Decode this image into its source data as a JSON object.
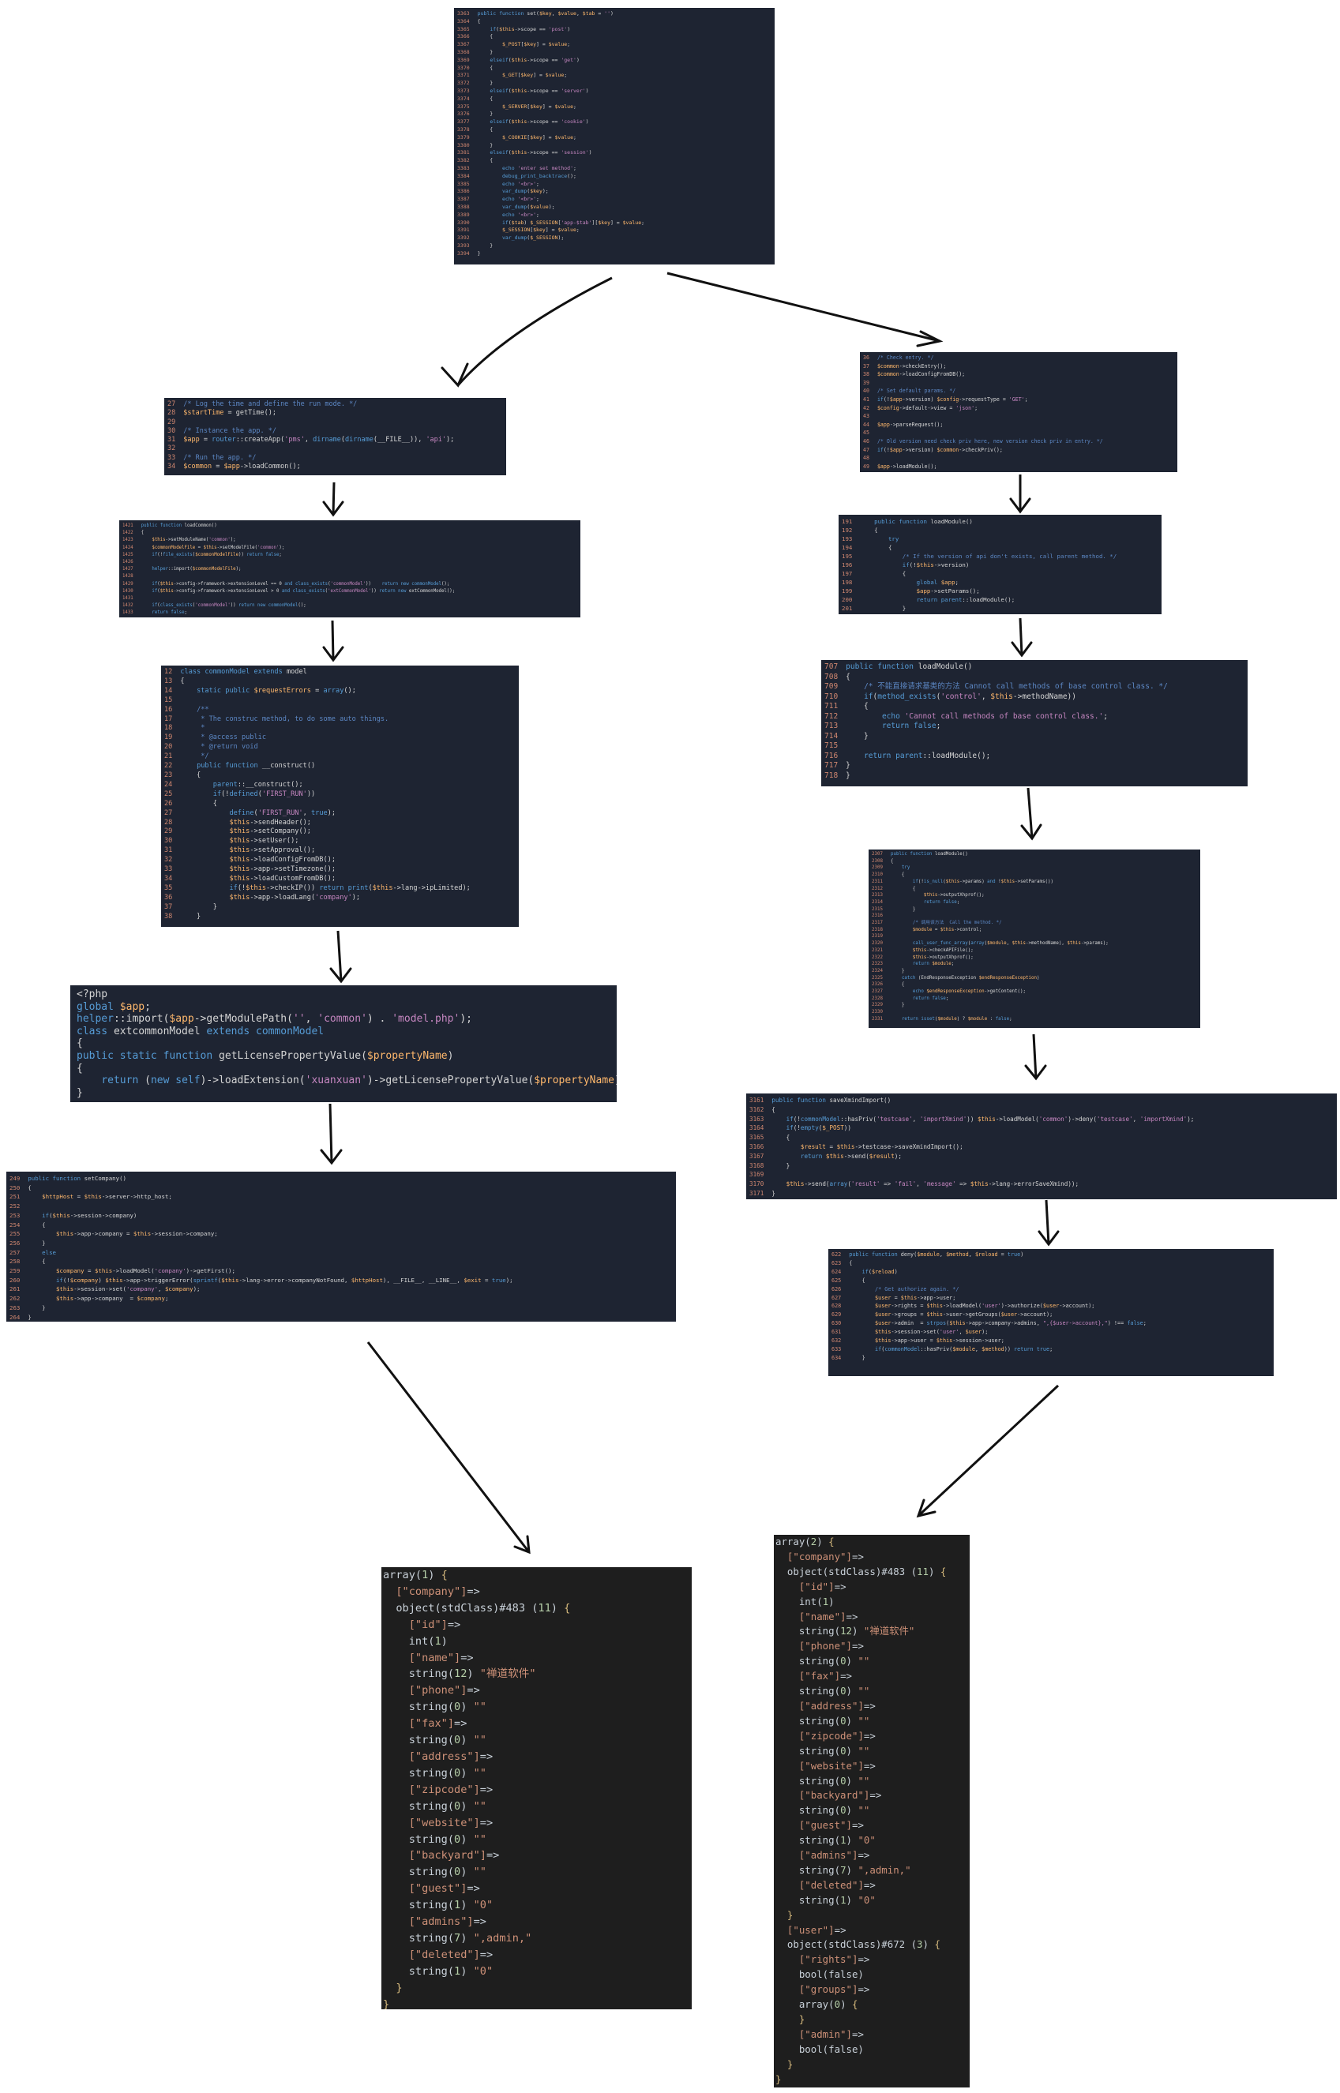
{
  "panels": {
    "top_set": {
      "start": 3363,
      "lines": [
        "public function set($key, $value, $tab = '')",
        "{",
        "    if($this->scope == 'post')",
        "    {",
        "        $_POST[$key] = $value;",
        "    }",
        "    elseif($this->scope == 'get')",
        "    {",
        "        $_GET[$key] = $value;",
        "    }",
        "    elseif($this->scope == 'server')",
        "    {",
        "        $_SERVER[$key] = $value;",
        "    }",
        "    elseif($this->scope == 'cookie')",
        "    {",
        "        $_COOKIE[$key] = $value;",
        "    }",
        "    elseif($this->scope == 'session')",
        "    {",
        "        echo 'enter set method';",
        "        debug_print_backtrace();",
        "        echo '<br>';",
        "        var_dump($key);",
        "        echo '<br>';",
        "        var_dump($value);",
        "        echo '<br>';",
        "        if($tab) $_SESSION['app-$tab'][$key] = $value;",
        "        $_SESSION[$key] = $value;",
        "        var_dump($_SESSION);",
        "    }",
        "}"
      ]
    },
    "left_run": {
      "start": 27,
      "lines": [
        "/* Log the time and define the run mode. */",
        "$startTime = getTime();",
        "",
        "/* Instance the app. */",
        "$app = router::createApp('pms', dirname(dirname(__FILE__)), 'api');",
        "",
        "/* Run the app. */",
        "$common = $app->loadCommon();"
      ]
    },
    "left_loadcommon": {
      "start": 1421,
      "lines": [
        "public function loadCommon()",
        "{",
        "    $this->setModuleName('common');",
        "    $commonModelFile = $this->setModelFile('common');",
        "    if(!file_exists($commonModelFile)) return false;",
        "",
        "    helper::import($commonModelFile);",
        "",
        "    if($this->config->framework->extensionLevel == 0 and class_exists('commonModel'))    return new commonModel();",
        "    if($this->config->framework->extensionLevel > 0 and class_exists('extCommonModel')) return new extCommonModel();",
        "",
        "    if(class_exists('commonModel')) return new commonModel();",
        "    return false;"
      ]
    },
    "left_commonmodel": {
      "start": 12,
      "lines": [
        "class commonModel extends model",
        "{",
        "    static public $requestErrors = array();",
        "",
        "    /**",
        "     * The construc method, to do some auto things.",
        "     *",
        "     * @access public",
        "     * @return void",
        "     */",
        "    public function __construct()",
        "    {",
        "        parent::__construct();",
        "        if(!defined('FIRST_RUN'))",
        "        {",
        "            define('FIRST_RUN', true);",
        "            $this->sendHeader();",
        "            $this->setCompany();",
        "            $this->setUser();",
        "            $this->setApproval();",
        "            $this->loadConfigFromDB();",
        "            $this->app->setTimezone();",
        "            $this->loadCustomFromDB();",
        "            if(!$this->checkIP()) return print($this->lang->ipLimited);",
        "            $this->app->loadLang('company');",
        "        }",
        "    }"
      ]
    },
    "left_ext": {
      "lines": [
        "<?php",
        "global $app;",
        "helper::import($app->getModulePath('', 'common') . 'model.php');",
        "class extcommonModel extends commonModel",
        "{",
        "public static function getLicensePropertyValue($propertyName)",
        "{",
        "    return (new self)->loadExtension('xuanxuan')->getLicensePropertyValue($propertyName);",
        "}"
      ]
    },
    "left_setcompany": {
      "start": 249,
      "lines": [
        "public function setCompany()",
        "{",
        "    $httpHost = $this->server->http_host;",
        "",
        "    if($this->session->company)",
        "    {",
        "        $this->app->company = $this->session->company;",
        "    }",
        "    else",
        "    {",
        "        $company = $this->loadModel('company')->getFirst();",
        "        if(!$company) $this->app->triggerError(sprintf($this->lang->error->companyNotFound, $httpHost), __FILE__, __LINE__, $exit = true);",
        "        $this->session->set('company', $company);",
        "        $this->app->company  = $company;",
        "    }",
        "}"
      ]
    },
    "right_checkentry": {
      "start": 36,
      "lines": [
        "/* Check entry. */",
        "$common->checkEntry();",
        "$common->loadConfigFromDB();",
        "",
        "/* Set default params. */",
        "if(!$app->version) $config->requestType = 'GET';",
        "$config->default->view = 'json';",
        "",
        "$app->parseRequest();",
        "",
        "/* Old version need check priv here, new version check priv in entry. */",
        "if(!$app->version) $common->checkPriv();",
        "",
        "$app->loadModule();"
      ]
    },
    "right_loadmodule1": {
      "start": 191,
      "lines": [
        "    public function loadModule()",
        "    {",
        "        try",
        "        {",
        "            /* If the version of api don't exists, call parent method. */",
        "            if(!$this->version)",
        "            {",
        "                global $app;",
        "                $app->setParams();",
        "                return parent::loadModule();",
        "            }"
      ]
    },
    "right_loadmodule2": {
      "start": 707,
      "lines": [
        "public function loadModule()",
        "{",
        "    /* 不能直接请求基类的方法 Cannot call methods of base control class. */",
        "    if(method_exists('control', $this->methodName))",
        "    {",
        "        echo 'Cannot call methods of base control class.';",
        "        return false;",
        "    }",
        "",
        "    return parent::loadModule();",
        "}",
        "}"
      ]
    },
    "right_loadmodule3": {
      "start": 2307,
      "lines": [
        "public function loadModule()",
        "{",
        "    try",
        "    {",
        "        if(!is_null($this->params) and !$this->setParams())",
        "        {",
        "            $this->outputXhprof();",
        "            return false;",
        "        }",
        "",
        "        /* 调用该方法  Call the method. */",
        "        $module = $this->control;",
        "",
        "        call_user_func_array(array($module, $this->methodName), $this->params);",
        "        $this->checkAPIFile();",
        "        $this->outputXhprof();",
        "        return $module;",
        "    }",
        "    catch (EndResponseException $endResponseException)",
        "    {",
        "        echo $endResponseException->getContent();",
        "        return false;",
        "    }",
        "",
        "    return isset($module) ? $module : false;"
      ]
    },
    "right_savexmind": {
      "start": 3161,
      "lines": [
        "public function saveXmindImport()",
        "{",
        "    if(!commonModel::hasPriv('testcase', 'importXmind')) $this->loadModel('common')->deny('testcase', 'importXmind');",
        "    if(!empty($_POST))",
        "    {",
        "        $result = $this->testcase->saveXmindImport();",
        "        return $this->send($result);",
        "    }",
        "",
        "    $this->send(array('result' => 'fail', 'message' => $this->lang->errorSaveXmind));",
        "}"
      ]
    },
    "right_deny": {
      "start": 622,
      "lines": [
        "public function deny($module, $method, $reload = true)",
        "{",
        "    if($reload)",
        "    {",
        "        /* Get authorize again. */",
        "        $user = $this->app->user;",
        "        $user->rights = $this->loadModel('user')->authorize($user->account);",
        "        $user->groups = $this->user->getGroups($user->account);",
        "        $user->admin  = strpos($this->app->company->admins, \",{$user->account},\") !== false;",
        "        $this->session->set('user', $user);",
        "        $this->app->user = $this->session->user;",
        "        if(commonModel::hasPriv($module, $method)) return true;",
        "    }"
      ]
    },
    "dump_left": {
      "lines": [
        "array(1) {",
        "  [\"company\"]=>",
        "  object(stdClass)#483 (11) {",
        "    [\"id\"]=>",
        "    int(1)",
        "    [\"name\"]=>",
        "    string(12) \"禅道软件\"",
        "    [\"phone\"]=>",
        "    string(0) \"\"",
        "    [\"fax\"]=>",
        "    string(0) \"\"",
        "    [\"address\"]=>",
        "    string(0) \"\"",
        "    [\"zipcode\"]=>",
        "    string(0) \"\"",
        "    [\"website\"]=>",
        "    string(0) \"\"",
        "    [\"backyard\"]=>",
        "    string(0) \"\"",
        "    [\"guest\"]=>",
        "    string(1) \"0\"",
        "    [\"admins\"]=>",
        "    string(7) \",admin,\"",
        "    [\"deleted\"]=>",
        "    string(1) \"0\"",
        "  }",
        "}"
      ]
    },
    "dump_right": {
      "lines": [
        "array(2) {",
        "  [\"company\"]=>",
        "  object(stdClass)#483 (11) {",
        "    [\"id\"]=>",
        "    int(1)",
        "    [\"name\"]=>",
        "    string(12) \"禅道软件\"",
        "    [\"phone\"]=>",
        "    string(0) \"\"",
        "    [\"fax\"]=>",
        "    string(0) \"\"",
        "    [\"address\"]=>",
        "    string(0) \"\"",
        "    [\"zipcode\"]=>",
        "    string(0) \"\"",
        "    [\"website\"]=>",
        "    string(0) \"\"",
        "    [\"backyard\"]=>",
        "    string(0) \"\"",
        "    [\"guest\"]=>",
        "    string(1) \"0\"",
        "    [\"admins\"]=>",
        "    string(7) \",admin,\"",
        "    [\"deleted\"]=>",
        "    string(1) \"0\"",
        "  }",
        "  [\"user\"]=>",
        "  object(stdClass)#672 (3) {",
        "    [\"rights\"]=>",
        "    bool(false)",
        "    [\"groups\"]=>",
        "    array(0) {",
        "    }",
        "    [\"admin\"]=>",
        "    bool(false)",
        "  }",
        "}"
      ]
    }
  },
  "colors": {
    "panel_bg": "#1e2432",
    "dump_bg": "#1e1e1e",
    "line_number": "#d08770",
    "keyword": "#569cd6",
    "variable": "#ffb86c",
    "string": "#c586c0",
    "comment": "#5c87c4",
    "arrow": "#111111"
  }
}
